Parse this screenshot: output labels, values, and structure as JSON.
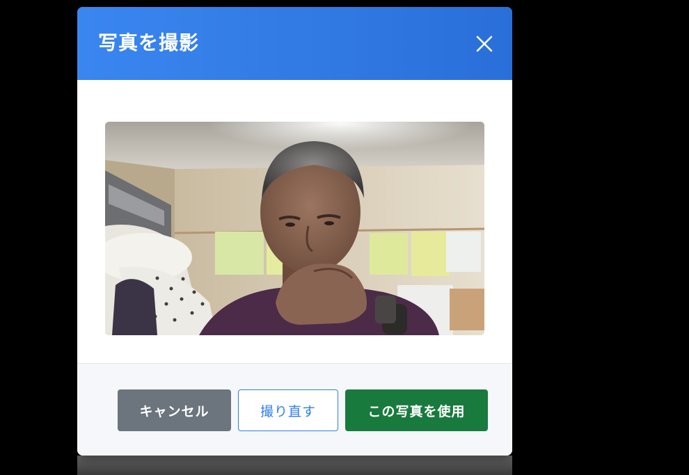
{
  "dialog": {
    "title": "写真を撮影",
    "close_icon": "close-icon"
  },
  "camera": {
    "preview_content": "webcam-photo"
  },
  "footer": {
    "cancel_label": "キャンセル",
    "retake_label": "撮り直す",
    "use_label": "この写真を使用"
  },
  "colors": {
    "header_start": "#3a86f0",
    "header_end": "#2a6fd9",
    "cancel_bg": "#6c757d",
    "retake_border": "#2f7ee8",
    "use_bg": "#197a3e",
    "footer_bg": "#f5f7fa"
  }
}
